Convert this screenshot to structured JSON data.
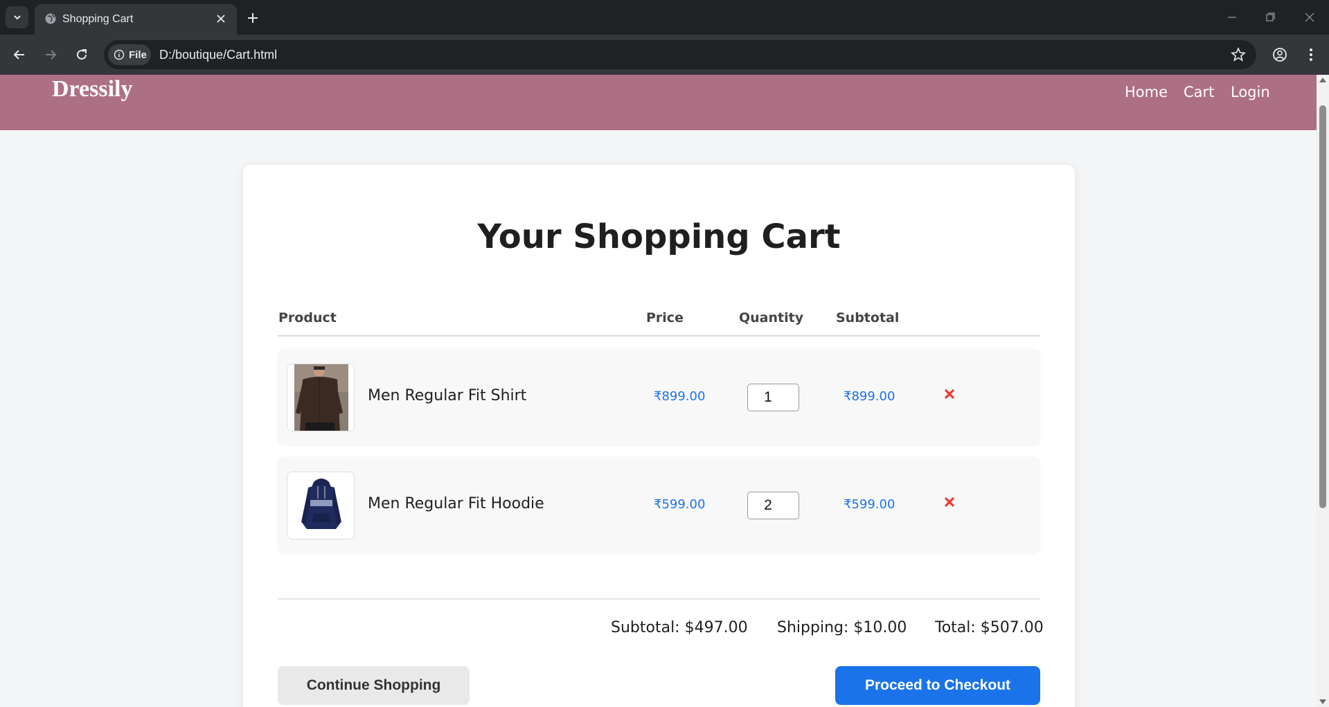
{
  "browser": {
    "tab_title": "Shopping Cart",
    "chip_label": "File",
    "url": "D:/boutique/Cart.html"
  },
  "site": {
    "logo": "Dressily",
    "nav": [
      "Home",
      "Cart",
      "Login"
    ],
    "header_color": "#ad6f84"
  },
  "cart": {
    "title": "Your Shopping Cart",
    "columns": [
      "Product",
      "Price",
      "Quantity",
      "Subtotal"
    ],
    "items": [
      {
        "name": "Men Regular Fit Shirt",
        "price": "₹899.00",
        "quantity": "1",
        "subtotal": "₹899.00",
        "image_icon": "shirt-photo"
      },
      {
        "name": "Men Regular Fit Hoodie",
        "price": "₹599.00",
        "quantity": "2",
        "subtotal": "₹599.00",
        "image_icon": "hoodie-photo"
      }
    ],
    "summary": {
      "subtotal": "Subtotal: $497.00",
      "shipping": "Shipping: $10.00",
      "total": "Total: $507.00"
    },
    "continue_label": "Continue Shopping",
    "checkout_label": "Proceed to Checkout",
    "accent_color": "#1a73e8",
    "remove_color": "#e53935"
  }
}
